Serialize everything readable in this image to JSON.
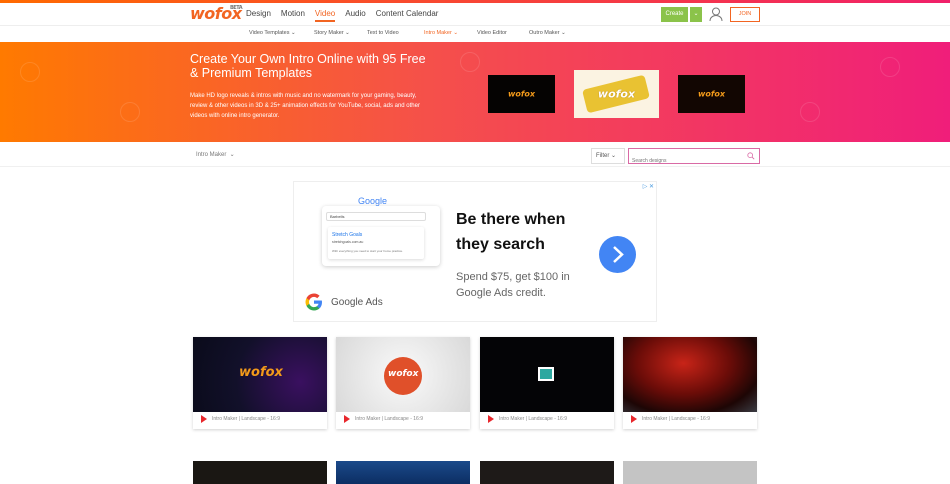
{
  "nav": {
    "logo": "wofox",
    "logo_badge": "BETA",
    "menu": [
      "Design",
      "Motion",
      "Video",
      "Audio",
      "Content Calendar"
    ],
    "active_menu": "Video",
    "create_label": "Create",
    "join_label": "JOIN"
  },
  "subnav": {
    "items": [
      "Video Templates",
      "Story Maker",
      "Text to Video",
      "Intro Maker",
      "Video Editor",
      "Outro Maker"
    ],
    "active": "Intro Maker"
  },
  "banner": {
    "title": "Create Your Own Intro Online with 95 Free & Premium Templates",
    "description": "Make HD logo reveals & intros with music and no watermark for your gaming, beauty, review & other videos in 3D & 25+ animation effects for YouTube, social, ads and other videos with online intro generator."
  },
  "filter": {
    "crumb": "Intro Maker",
    "filter_label": "Filter",
    "search_placeholder": "Search designs"
  },
  "ad": {
    "mock_brand": "Google",
    "mock_query": "Barbells",
    "mock_result_title": "Stretch Goals",
    "mock_result_url": "stretchgoals.com.au",
    "mock_result_desc": "With everything you need to start your home practice.",
    "headline": "Be there when they search",
    "subtext": "Spend $75, get $100 in Google Ads credit.",
    "brand": "Google Ads"
  },
  "cards": [
    {
      "caption": "Intro Maker | Landscape - 16:9"
    },
    {
      "caption": "Intro Maker | Landscape - 16:9"
    },
    {
      "caption": "Intro Maker | Landscape - 16:9"
    },
    {
      "caption": "Intro Maker | Landscape - 16:9"
    }
  ],
  "colors": {
    "accent": "#f26522",
    "create": "#8bc34a",
    "play": "#e8272c",
    "ad_button": "#4285f4"
  }
}
